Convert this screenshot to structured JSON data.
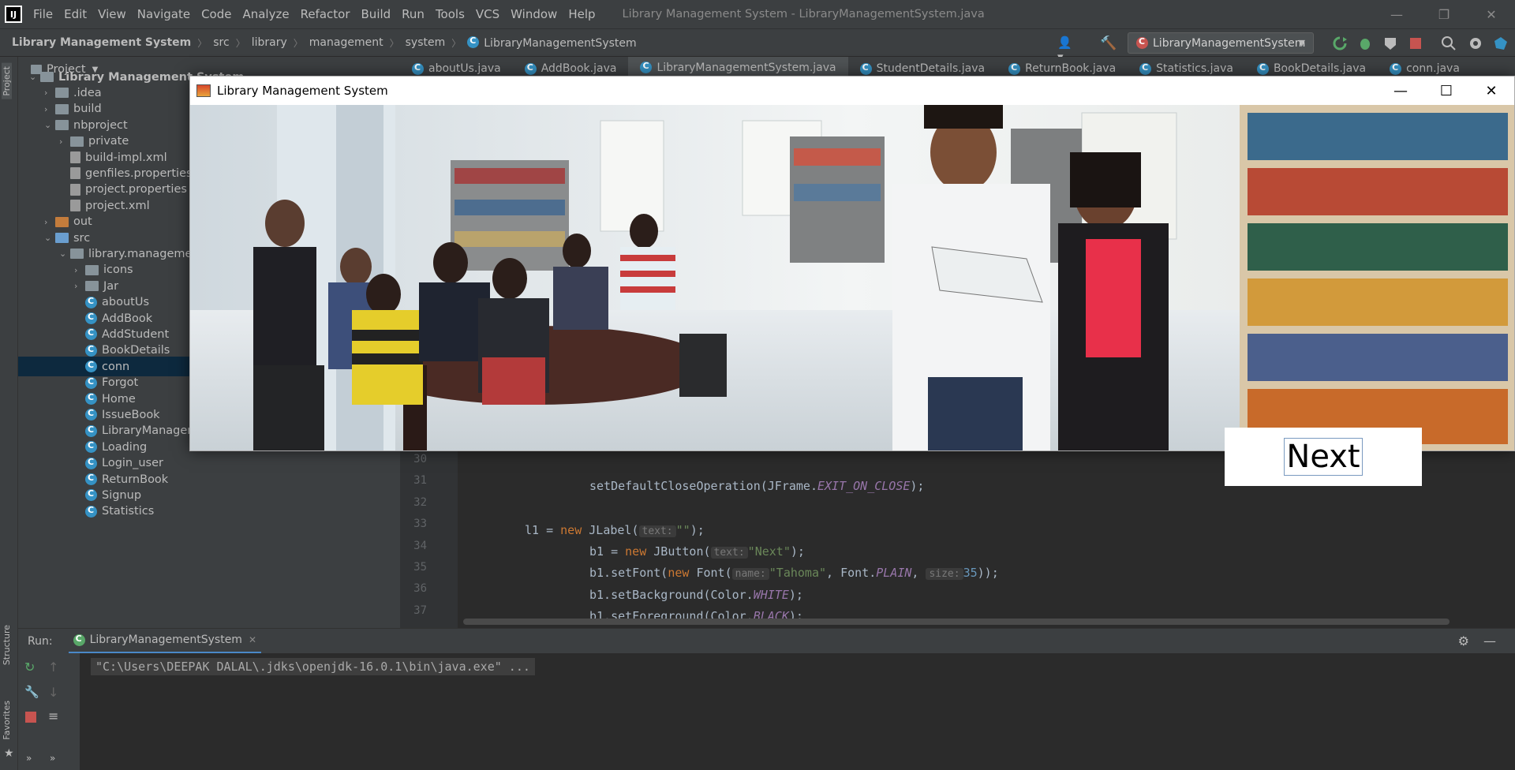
{
  "ide": {
    "menu": [
      "File",
      "Edit",
      "View",
      "Navigate",
      "Code",
      "Analyze",
      "Refactor",
      "Build",
      "Run",
      "Tools",
      "VCS",
      "Window",
      "Help"
    ],
    "window_title": "Library Management System - LibraryManagementSystem.java",
    "logo": "IJ",
    "breadcrumb": [
      "Library Management System",
      "src",
      "library",
      "management",
      "system",
      "LibraryManagementSystem"
    ],
    "run_config": "LibraryManagementSystem",
    "left_stripe": {
      "project": "Project",
      "structure": "Structure",
      "favorites": "Favorites"
    },
    "project_panel": {
      "title": "Project",
      "tree": [
        {
          "label": "Library Management System",
          "depth": 0,
          "type": "folder",
          "expanded": true
        },
        {
          "label": ".idea",
          "depth": 1,
          "type": "folder",
          "expanded": false
        },
        {
          "label": "build",
          "depth": 1,
          "type": "folder",
          "expanded": false
        },
        {
          "label": "nbproject",
          "depth": 1,
          "type": "folder",
          "expanded": true
        },
        {
          "label": "private",
          "depth": 2,
          "type": "folder",
          "expanded": false
        },
        {
          "label": "build-impl.xml",
          "depth": 2,
          "type": "file"
        },
        {
          "label": "genfiles.properties",
          "depth": 2,
          "type": "file"
        },
        {
          "label": "project.properties",
          "depth": 2,
          "type": "file"
        },
        {
          "label": "project.xml",
          "depth": 2,
          "type": "file"
        },
        {
          "label": "out",
          "depth": 1,
          "type": "folder-orange",
          "expanded": false
        },
        {
          "label": "src",
          "depth": 1,
          "type": "folder-blue",
          "expanded": true
        },
        {
          "label": "library.managemen",
          "depth": 2,
          "type": "folder",
          "expanded": true
        },
        {
          "label": "icons",
          "depth": 3,
          "type": "folder",
          "expanded": false
        },
        {
          "label": "Jar",
          "depth": 3,
          "type": "folder",
          "expanded": false
        },
        {
          "label": "aboutUs",
          "depth": 3,
          "type": "class"
        },
        {
          "label": "AddBook",
          "depth": 3,
          "type": "class"
        },
        {
          "label": "AddStudent",
          "depth": 3,
          "type": "class"
        },
        {
          "label": "BookDetails",
          "depth": 3,
          "type": "class"
        },
        {
          "label": "conn",
          "depth": 3,
          "type": "class",
          "selected": true
        },
        {
          "label": "Forgot",
          "depth": 3,
          "type": "class"
        },
        {
          "label": "Home",
          "depth": 3,
          "type": "class"
        },
        {
          "label": "IssueBook",
          "depth": 3,
          "type": "class"
        },
        {
          "label": "LibraryManagementSystem",
          "depth": 3,
          "type": "class"
        },
        {
          "label": "Loading",
          "depth": 3,
          "type": "class"
        },
        {
          "label": "Login_user",
          "depth": 3,
          "type": "class"
        },
        {
          "label": "ReturnBook",
          "depth": 3,
          "type": "class"
        },
        {
          "label": "Signup",
          "depth": 3,
          "type": "class"
        },
        {
          "label": "Statistics",
          "depth": 3,
          "type": "class"
        }
      ]
    },
    "tabs": [
      "aboutUs.java",
      "AddBook.java",
      "LibraryManagementSystem.java",
      "StudentDetails.java",
      "ReturnBook.java",
      "Statistics.java",
      "BookDetails.java",
      "conn.java"
    ],
    "active_tab": "LibraryManagementSystem.java",
    "code_lines": [
      {
        "n": "30"
      },
      {
        "n": "31"
      },
      {
        "n": "32"
      },
      {
        "n": "33"
      },
      {
        "n": "34"
      },
      {
        "n": "35"
      },
      {
        "n": "36"
      },
      {
        "n": "37"
      }
    ],
    "code": {
      "l31": "setDefaultCloseOperation(JFrame.",
      "l31_const": "EXIT_ON_CLOSE",
      "l31_end": ");",
      "l33_a": "l1 = ",
      "l33_kw": "new",
      "l33_b": " JLabel(",
      "l33_hint": "text:",
      "l33_str": "\"\"",
      "l33_end": ");",
      "l34_a": "b1 = ",
      "l34_kw": "new",
      "l34_b": " JButton(",
      "l34_hint": "text:",
      "l34_str": "\"Next\"",
      "l34_end": ");",
      "l35_a": "b1.setFont(",
      "l35_kw": "new",
      "l35_b": " Font(",
      "l35_hint1": "name:",
      "l35_str": "\"Tahoma\"",
      "l35_c": ", Font.",
      "l35_const": "PLAIN",
      "l35_d": ", ",
      "l35_hint2": "size:",
      "l35_num": "35",
      "l35_end": "));",
      "l36_a": "b1.setBackground(Color.",
      "l36_const": "WHITE",
      "l36_end": ");",
      "l37_a": "b1.setForeground(Color.",
      "l37_const": "BLACK",
      "l37_end": ");"
    },
    "run": {
      "label": "Run:",
      "tab": "LibraryManagementSystem",
      "console": "\"C:\\Users\\DEEPAK DALAL\\.jdks\\openjdk-16.0.1\\bin\\java.exe\" ..."
    }
  },
  "app_window": {
    "title": "Library Management System",
    "button_label": "Next",
    "minimize": "—",
    "maximize": "☐",
    "close": "✕"
  },
  "colors": {
    "accent": "#4a88c7",
    "ide_bg": "#2b2b2b",
    "panel_bg": "#3c3f41",
    "selection": "#0d293e"
  }
}
